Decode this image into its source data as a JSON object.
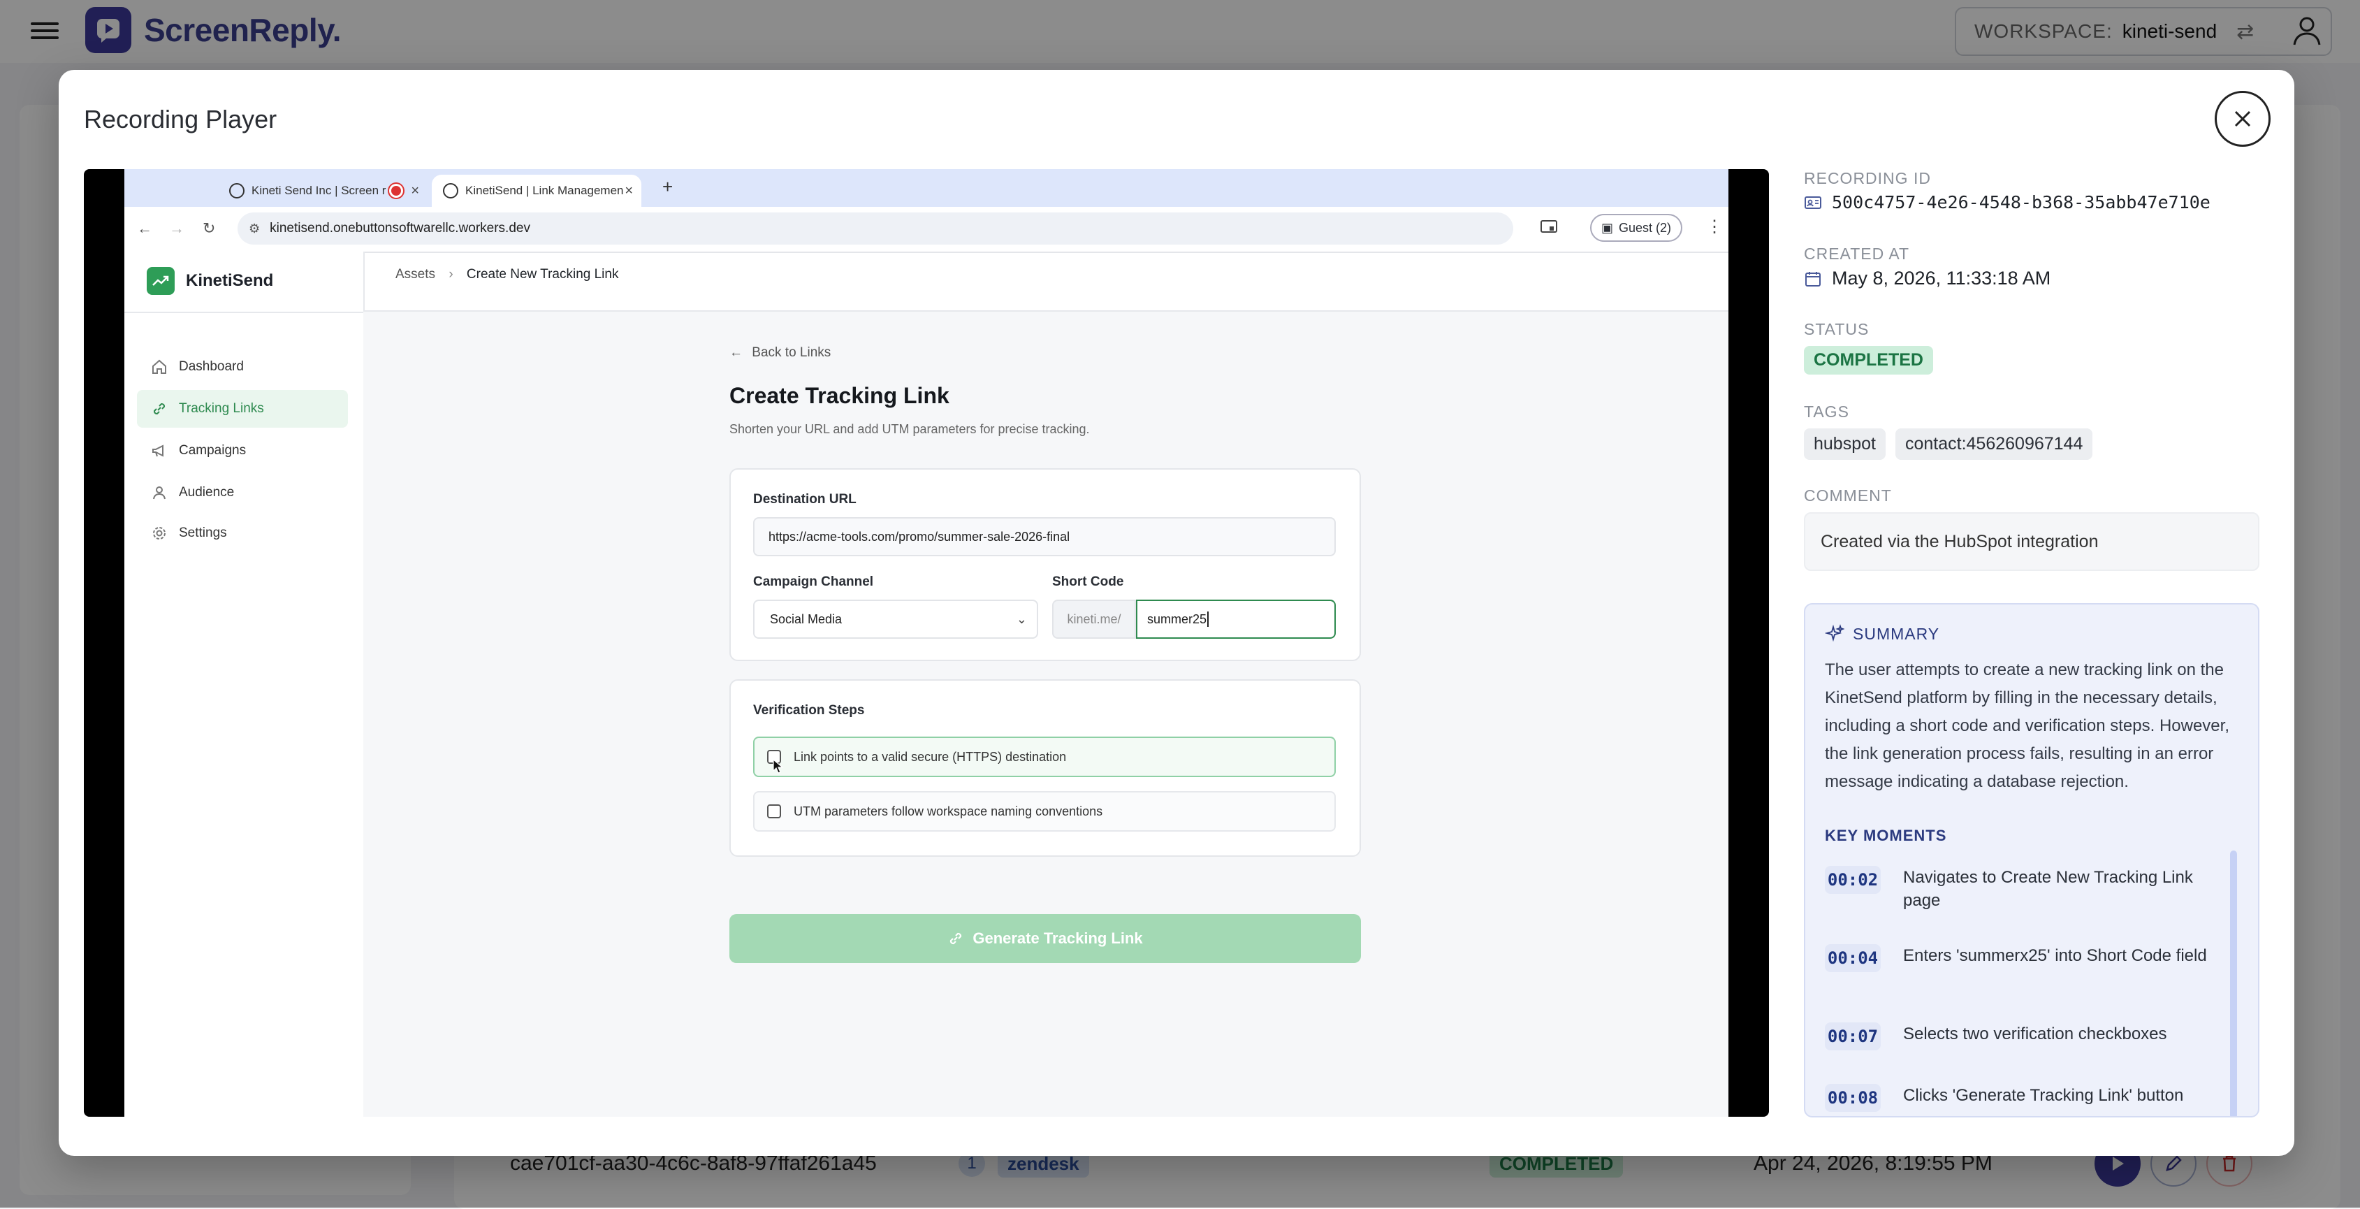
{
  "app": {
    "name": "ScreenReply.",
    "workspace_label": "WORKSPACE:",
    "workspace_value": "kineti-send"
  },
  "background_row": {
    "id": "cae701cf-aa30-4c6c-8af8-97ffaf261a45",
    "count": "1",
    "tag": "zendesk",
    "status": "COMPLETED",
    "date": "Apr 24, 2026, 8:19:55 PM"
  },
  "modal": {
    "title": "Recording Player"
  },
  "video": {
    "browser": {
      "tab1_title": "Kineti Send Inc | Screen r",
      "tab2_title": "KinetiSend | Link Managemen",
      "url": "kinetisend.onebuttonsoftwarellc.workers.dev",
      "guest_label": "Guest (2)"
    },
    "sidebar": {
      "brand": "KinetiSend",
      "items": [
        {
          "label": "Dashboard",
          "icon": "home-icon"
        },
        {
          "label": "Tracking Links",
          "icon": "link-icon"
        },
        {
          "label": "Campaigns",
          "icon": "megaphone-icon"
        },
        {
          "label": "Audience",
          "icon": "person-icon"
        },
        {
          "label": "Settings",
          "icon": "gear-icon"
        }
      ]
    },
    "breadcrumb": {
      "parent": "Assets",
      "current": "Create New Tracking Link"
    },
    "page": {
      "back_link": "Back to Links",
      "title": "Create Tracking Link",
      "subtitle": "Shorten your URL and add UTM parameters for precise tracking.",
      "destination_label": "Destination URL",
      "destination_value": "https://acme-tools.com/promo/summer-sale-2026-final",
      "channel_label": "Campaign Channel",
      "channel_value": "Social Media",
      "shortcode_label": "Short Code",
      "shortcode_prefix": "kineti.me/",
      "shortcode_value": "summer25",
      "verification_title": "Verification Steps",
      "check1": "Link points to a valid secure (HTTPS) destination",
      "check2": "UTM parameters follow workspace naming conventions",
      "generate_label": "Generate Tracking Link"
    }
  },
  "info": {
    "recording_id_label": "RECORDING ID",
    "recording_id": "500c4757-4e26-4548-b368-35abb47e710e",
    "created_label": "CREATED AT",
    "created_value": "May 8, 2026, 11:33:18 AM",
    "status_label": "STATUS",
    "status_value": "COMPLETED",
    "tags_label": "TAGS",
    "tags": [
      "hubspot",
      "contact:456260967144"
    ],
    "comment_label": "COMMENT",
    "comment_value": "Created via the HubSpot integration",
    "summary_label": "SUMMARY",
    "summary_text": "The user attempts to create a new tracking link on the KinetSend platform by filling in the necessary details, including a short code and verification steps. However, the link generation process fails, resulting in an error message indicating a database rejection.",
    "key_moments_label": "KEY MOMENTS",
    "key_moments": [
      {
        "time": "00:02",
        "text": "Navigates to Create New Tracking Link page"
      },
      {
        "time": "00:04",
        "text": "Enters 'summerx25' into Short Code field"
      },
      {
        "time": "00:07",
        "text": "Selects two verification checkboxes"
      },
      {
        "time": "00:08",
        "text": "Clicks 'Generate Tracking Link' button"
      }
    ]
  },
  "colors": {
    "brand": "#3d3a9c",
    "accent_green": "#2e8a4f",
    "status_green_bg": "#cdeedb",
    "summary_bg": "#eef1fb"
  }
}
